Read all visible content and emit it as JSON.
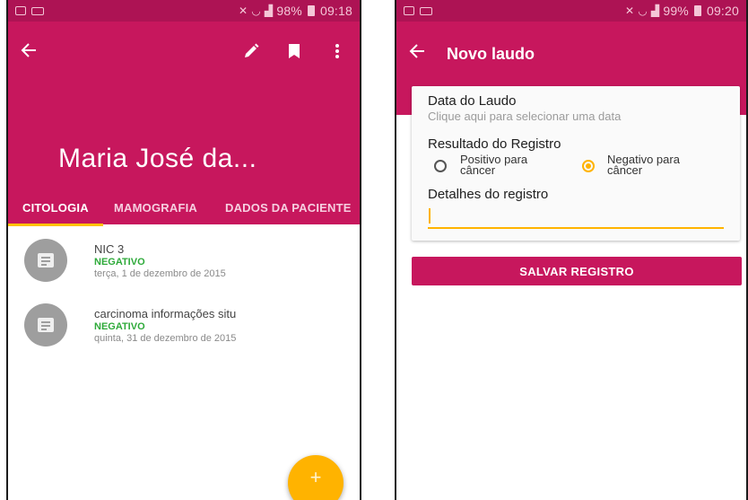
{
  "left_screen": {
    "status_bar": {
      "battery": "98%",
      "time": "09:18"
    },
    "patient_name": "Maria José da...",
    "tabs": [
      {
        "label": "CITOLOGIA",
        "active": true
      },
      {
        "label": "MAMOGRAFIA",
        "active": false
      },
      {
        "label": "DADOS DA PACIENTE",
        "active": false
      }
    ],
    "records": [
      {
        "title": "NIC 3",
        "status": "NEGATIVO",
        "date": "terça, 1 de dezembro de 2015"
      },
      {
        "title": "carcinoma informações situ",
        "status": "NEGATIVO",
        "date": "quinta, 31 de dezembro de 2015"
      }
    ],
    "fab_label": "+"
  },
  "right_screen": {
    "status_bar": {
      "battery": "99%",
      "time": "09:20"
    },
    "title": "Novo laudo",
    "date_label": "Data do Laudo",
    "date_hint": "Clique aqui para selecionar uma data",
    "result_label": "Resultado do Registro",
    "options": [
      {
        "line1": "Positivo para",
        "line2": "câncer",
        "selected": false
      },
      {
        "line1": "Negativo para",
        "line2": "câncer",
        "selected": true
      }
    ],
    "details_label": "Detalhes do registro",
    "details_value": "",
    "save_label": "SALVAR REGISTRO"
  },
  "colors": {
    "primary": "#c7175d",
    "primary_dark": "#ad1354",
    "accent": "#ffb300",
    "status_negative": "#2eaa3a"
  },
  "icons": [
    "back-arrow-icon",
    "edit-pencil-icon",
    "bookmark-icon",
    "overflow-menu-icon",
    "document-icon",
    "add-icon"
  ]
}
